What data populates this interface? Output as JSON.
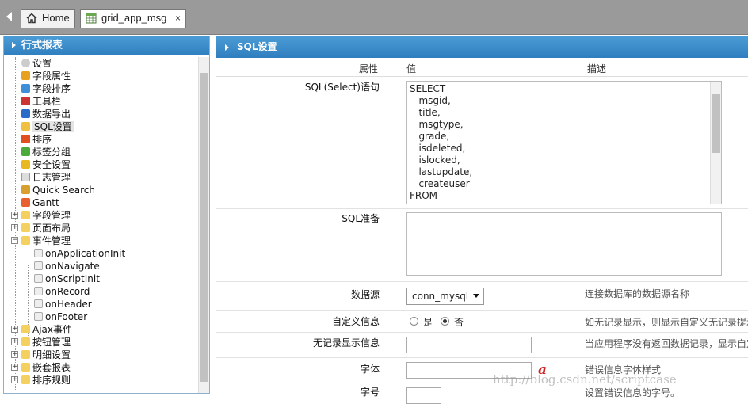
{
  "tabs": {
    "home": "Home",
    "app": "grid_app_msg",
    "close": "×"
  },
  "left": {
    "title": "行式报表",
    "items": [
      "设置",
      "字段属性",
      "字段排序",
      "工具栏",
      "数据导出",
      "SQL设置",
      "排序",
      "标签分组",
      "安全设置",
      "日志管理",
      "Quick Search",
      "Gantt",
      "字段管理",
      "页面布局",
      "事件管理",
      "onApplicationInit",
      "onNavigate",
      "onScriptInit",
      "onRecord",
      "onHeader",
      "onFooter",
      "Ajax事件",
      "按钮管理",
      "明细设置",
      "嵌套报表",
      "排序规则"
    ]
  },
  "main": {
    "title": "SQL设置",
    "col_property": "属性",
    "col_value": "值",
    "col_desc": "描述",
    "sql_label": "SQL(Select)语句",
    "sql_lines": [
      "SELECT",
      "   msgid,",
      "   title,",
      "   msgtype,",
      "   grade,",
      "   isdeleted,",
      "   islocked,",
      "   lastupdate,",
      "   createuser",
      "FROM"
    ],
    "prep_label": "SQL准备",
    "ds_label": "数据源",
    "ds_value": "conn_mysql",
    "ds_desc": "连接数据库的数据源名称",
    "custom_label": "自定义信息",
    "yes": "是",
    "no": "否",
    "custom_desc": "如无记录显示，则显示自定义无记录提示",
    "norec_label": "无记录显示信息",
    "norec_desc": "当应用程序没有返回数据记录，显示自定",
    "font_label": "字体",
    "font_desc": "错误信息字体样式",
    "size_label": "字号",
    "size_desc": "设置错误信息的字号。"
  },
  "watermark": "http://blog.csdn.net/scriptcase"
}
